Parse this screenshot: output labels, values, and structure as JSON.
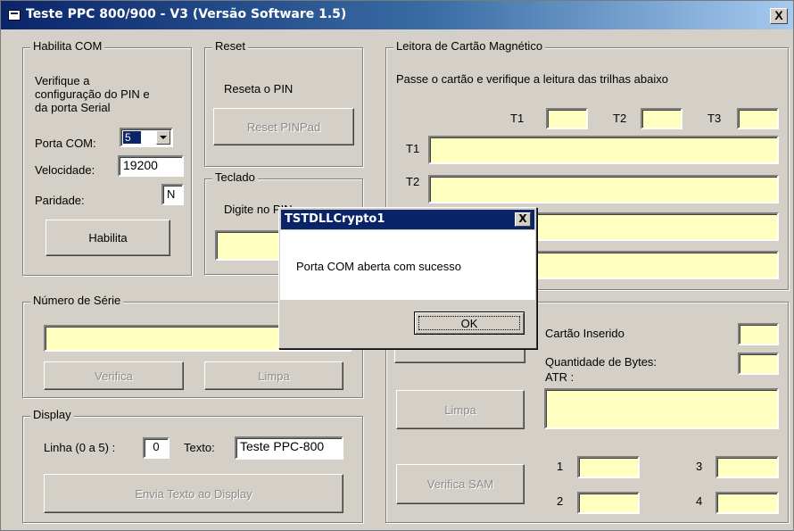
{
  "window": {
    "title": "Teste PPC 800/900 - V3 (Versão Software 1.5)",
    "close_glyph": "X"
  },
  "habilita_com": {
    "legend": "Habilita COM",
    "instructions": [
      "Verifique a",
      "configuração do PIN e",
      "da porta Serial"
    ],
    "porta_label": "Porta COM:",
    "porta_value": "5",
    "velocidade_label": "Velocidade:",
    "velocidade_value": "19200",
    "paridade_label": "Paridade:",
    "paridade_value": "N",
    "habilita_button": "Habilita"
  },
  "reset": {
    "legend": "Reset",
    "text": "Reseta o PIN",
    "button": "Reset PINPad"
  },
  "teclado": {
    "legend": "Teclado",
    "text": "Digite no PIN"
  },
  "leitora": {
    "legend": "Leitora de Cartão Magnético",
    "instruction": "Passe o cartão e verifique a leitura das trilhas abaixo",
    "t1_label": "T1",
    "t2_label": "T2",
    "t3_label": "T3",
    "row_t1_label": "T1",
    "row_t2_label": "T2"
  },
  "numero_serie": {
    "legend": "Número de Série",
    "verifica_button": "Verifica",
    "limpa_button": "Limpa"
  },
  "smartcard": {
    "cartao_inserido_label": "Cartão Inserido",
    "quantidade_bytes_label": "Quantidade de Bytes:",
    "atr_label": "ATR :",
    "limpa_button": "Limpa",
    "verifica_sam_button": "Verifica SAM",
    "slot1_label": "1",
    "slot2_label": "2",
    "slot3_label": "3",
    "slot4_label": "4"
  },
  "display": {
    "legend": "Display",
    "linha_label": "Linha (0 a 5) :",
    "linha_value": "0",
    "texto_label": "Texto:",
    "texto_value": "Teste PPC-800",
    "envia_button": "Envia Texto ao Display"
  },
  "dialog": {
    "title": "TSTDLLCrypto1",
    "close_glyph": "X",
    "message": "Porta COM aberta com sucesso",
    "ok_button": "OK"
  },
  "colors": {
    "titlebar": "#0a246a",
    "face": "#d4d0c8",
    "yellow_field": "#ffffc0"
  }
}
